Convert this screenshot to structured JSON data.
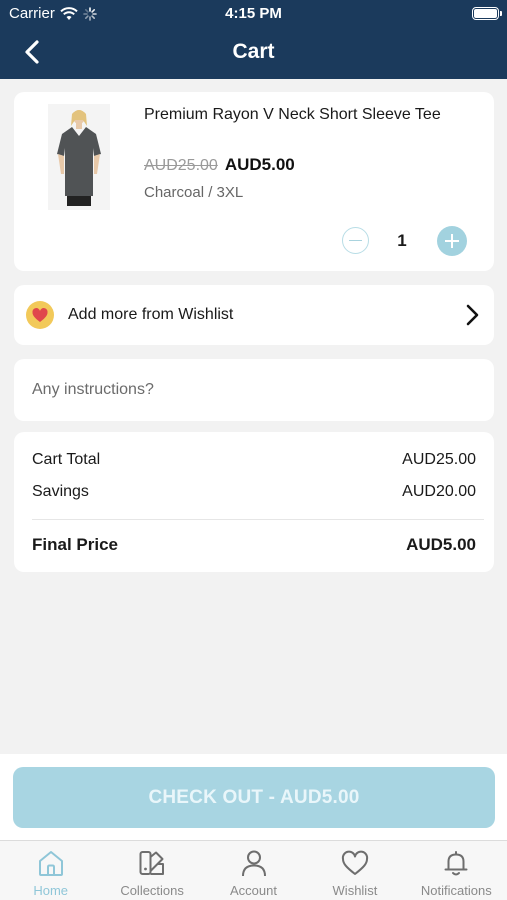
{
  "status_bar": {
    "carrier": "Carrier",
    "time": "4:15 PM"
  },
  "nav": {
    "title": "Cart"
  },
  "cart_item": {
    "name": "Premium Rayon V Neck Short Sleeve Tee",
    "original_price": "AUD25.00",
    "sale_price": "AUD5.00",
    "variant": "Charcoal / 3XL",
    "quantity": "1"
  },
  "wishlist_link": {
    "label": "Add more from Wishlist"
  },
  "instructions": {
    "placeholder": "Any instructions?",
    "value": ""
  },
  "summary": {
    "cart_total_label": "Cart Total",
    "cart_total_value": "AUD25.00",
    "savings_label": "Savings",
    "savings_value": "AUD20.00",
    "final_label": "Final Price",
    "final_value": "AUD5.00"
  },
  "checkout": {
    "label": "CHECK OUT - AUD5.00"
  },
  "tabs": [
    {
      "label": "Home",
      "icon": "home-icon",
      "active": true
    },
    {
      "label": "Collections",
      "icon": "collections-icon",
      "active": false
    },
    {
      "label": "Account",
      "icon": "account-icon",
      "active": false
    },
    {
      "label": "Wishlist",
      "icon": "heart-icon",
      "active": false
    },
    {
      "label": "Notifications",
      "icon": "bell-icon",
      "active": false
    }
  ],
  "colors": {
    "header": "#1b3a5c",
    "accent": "#a8d5e2",
    "active_tab": "#8fc6d8",
    "wishlist_badge": "#f2c95a",
    "heart": "#e0474c"
  }
}
